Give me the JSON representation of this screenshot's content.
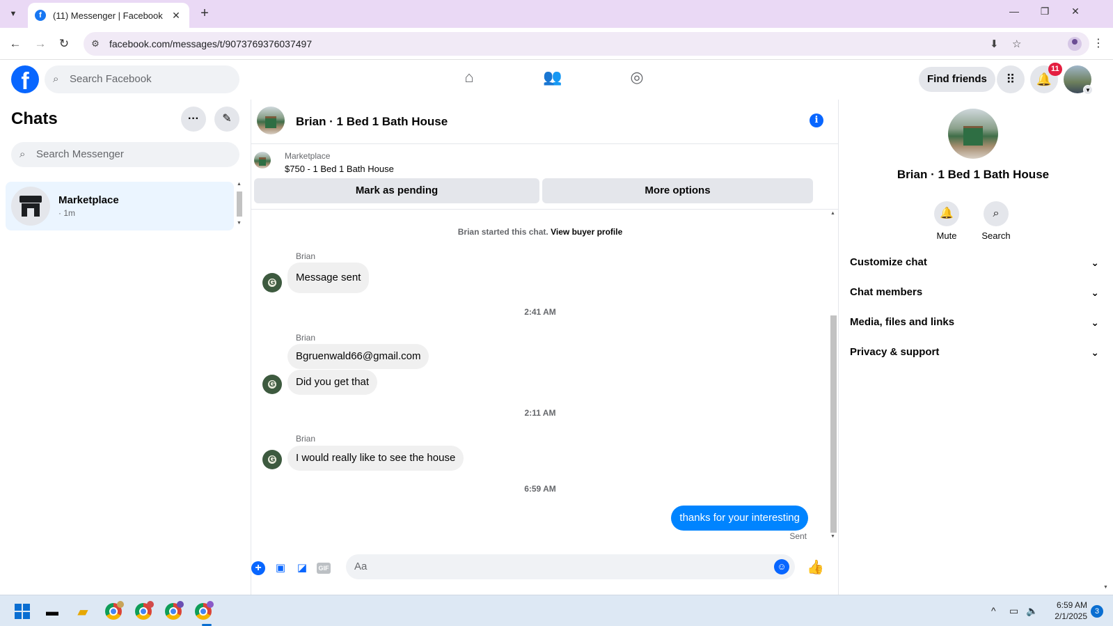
{
  "browser": {
    "tab_title": "(11) Messenger | Facebook",
    "url": "facebook.com/messages/t/9073769376037497"
  },
  "fb": {
    "search_placeholder": "Search Facebook",
    "find_friends": "Find friends",
    "notification_count": "11"
  },
  "chats": {
    "title": "Chats",
    "search_placeholder": "Search Messenger",
    "items": [
      {
        "name": "Marketplace",
        "sub": "· 1m"
      }
    ]
  },
  "conversation": {
    "title": "Brian · 1 Bed 1 Bath House",
    "marketplace_label": "Marketplace",
    "listing": "$750 - 1 Bed 1 Bath House",
    "mark_pending": "Mark as pending",
    "more_options": "More options",
    "started_text": "Brian started this chat.",
    "view_buyer": "View buyer profile",
    "sender": "Brian",
    "messages": [
      {
        "text": "Message sent"
      },
      {
        "text": "Bgruenwald66@gmail.com"
      },
      {
        "text": "Did you get that"
      },
      {
        "text": "I would really like to see the house"
      },
      {
        "text": "thanks for your interesting"
      }
    ],
    "timestamps": [
      "2:41 AM",
      "2:11 AM",
      "6:59 AM"
    ],
    "sent_label": "Sent",
    "composer_placeholder": "Aa"
  },
  "right_panel": {
    "name": "Brian · 1 Bed 1 Bath House",
    "actions": [
      "Mute",
      "Search"
    ],
    "sections": [
      "Customize chat",
      "Chat members",
      "Media, files and links",
      "Privacy & support"
    ]
  },
  "taskbar": {
    "time": "6:59 AM",
    "date": "2/1/2025",
    "notifications": "3"
  },
  "colors": {
    "brand_blue": "#0866ff",
    "bubble_blue": "#0084ff",
    "selected_chat_bg": "#ebf5ff"
  }
}
